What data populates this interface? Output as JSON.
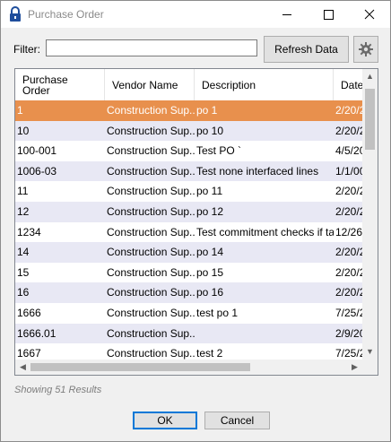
{
  "window": {
    "title": "Purchase Order"
  },
  "toolbar": {
    "filter_label": "Filter:",
    "filter_value": "",
    "refresh_label": "Refresh Data"
  },
  "table": {
    "columns": [
      "Purchase\nOrder",
      "Vendor Name",
      "Description",
      "Date"
    ],
    "rows": [
      [
        "1",
        "Construction Sup...",
        "po 1",
        "2/20/2"
      ],
      [
        "10",
        "Construction Sup...",
        "po 10",
        "2/20/2"
      ],
      [
        "100-001",
        "Construction Sup...",
        "Test PO `",
        "4/5/20"
      ],
      [
        "1006-03",
        "Construction Sup...",
        "Test none interfaced lines",
        "1/1/00"
      ],
      [
        "11",
        "Construction Sup...",
        "po 11",
        "2/20/2"
      ],
      [
        "12",
        "Construction Sup...",
        "po 12",
        "2/20/2"
      ],
      [
        "1234",
        "Construction Sup...",
        "Test commitment checks if ta...",
        "12/26/"
      ],
      [
        "14",
        "Construction Sup...",
        "po 14",
        "2/20/2"
      ],
      [
        "15",
        "Construction Sup...",
        "po 15",
        "2/20/2"
      ],
      [
        "16",
        "Construction Sup...",
        "po 16",
        "2/20/2"
      ],
      [
        "1666",
        "Construction Sup...",
        "test po 1",
        "7/25/2"
      ],
      [
        "1666.01",
        "Construction Sup...",
        "",
        "2/9/20"
      ],
      [
        "1667",
        "Construction Sup...",
        "test 2",
        "7/25/2"
      ]
    ],
    "selected_row": 0
  },
  "footer": {
    "results_text": "Showing 51 Results",
    "ok_label": "OK",
    "cancel_label": "Cancel"
  },
  "colors": {
    "selected_row": "#e8904d",
    "alt_row": "#e8e8f4",
    "default_button_border": "#0078d7"
  },
  "icons": {
    "app": "lock-icon",
    "minimize": "minimize-icon",
    "maximize": "maximize-icon",
    "close": "close-icon",
    "settings": "gear-icon"
  }
}
